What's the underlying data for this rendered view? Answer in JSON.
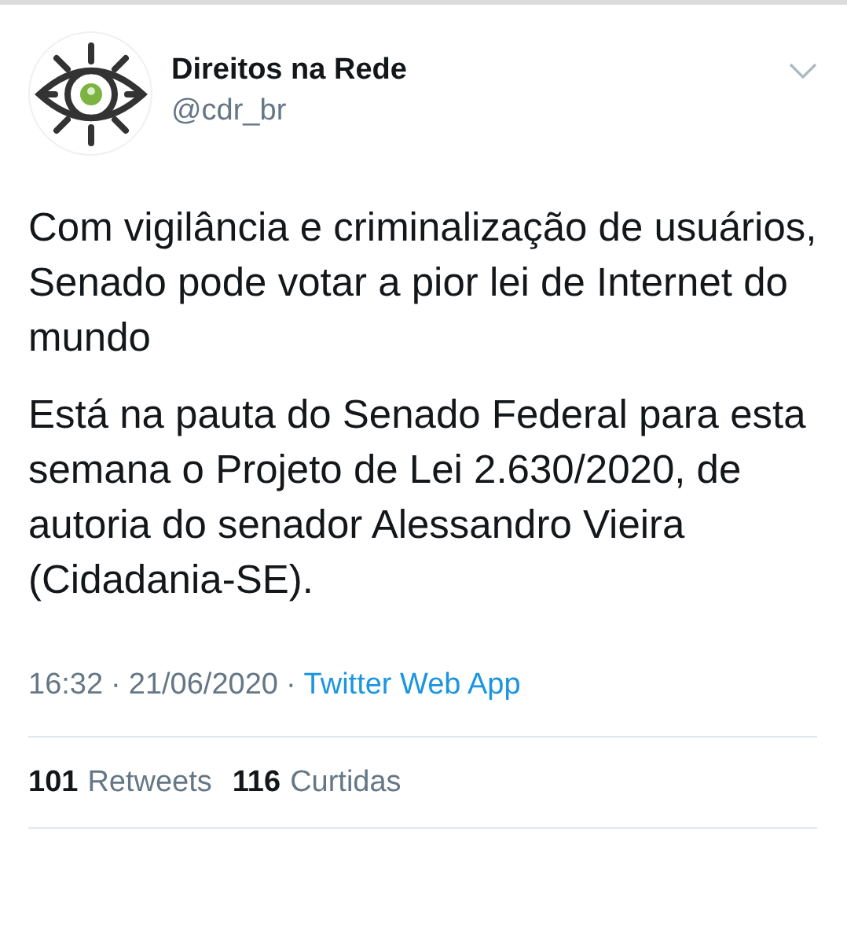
{
  "author": {
    "name": "Direitos na Rede",
    "handle": "@cdr_br"
  },
  "tweet": {
    "headline": "Com vigilância e criminalização de usuários, Senado pode votar a pior lei de Internet do mundo",
    "body": "Está na pauta do Senado Federal para esta semana o Projeto de Lei 2.630/2020, de autoria do senador Alessandro Vieira (Cidadania-SE)."
  },
  "meta": {
    "time": "16:32",
    "separator_1": "·",
    "date": "21/06/2020",
    "separator_2": "·",
    "source": "Twitter Web App"
  },
  "stats": [
    {
      "count": "101",
      "label": "Retweets"
    },
    {
      "count": "116",
      "label": "Curtidas"
    }
  ]
}
